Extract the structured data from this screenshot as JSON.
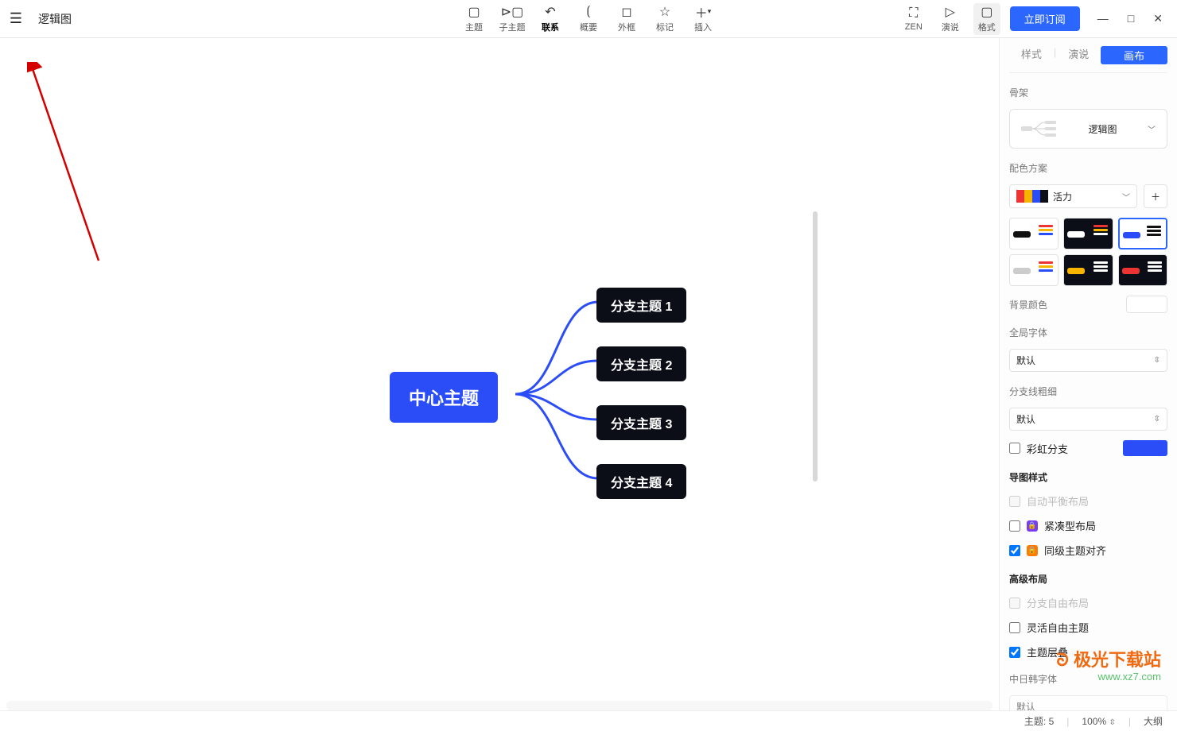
{
  "header": {
    "doc_title": "逻辑图",
    "toolbar": [
      {
        "icon": "▢",
        "label": "主题"
      },
      {
        "icon": "⊳▢",
        "label": "子主题"
      },
      {
        "icon": "↶",
        "label": "联系",
        "active": true
      },
      {
        "icon": "⟮ ",
        "label": "概要"
      },
      {
        "icon": "◻",
        "label": "外框"
      },
      {
        "icon": "☆",
        "label": "标记"
      },
      {
        "icon": "＋",
        "label": "插入",
        "sub": "▾"
      }
    ],
    "right_tools": [
      {
        "icon": "⛶",
        "label": "ZEN"
      },
      {
        "icon": "▷",
        "label": "演说"
      },
      {
        "icon": "▢",
        "label": "格式",
        "boxed": true
      }
    ],
    "subscribe": "立即订阅",
    "window": {
      "min": "—",
      "max": "□",
      "close": "✕"
    }
  },
  "mindmap": {
    "center": "中心主题",
    "branches": [
      "分支主题 1",
      "分支主题 2",
      "分支主题 3",
      "分支主题 4"
    ]
  },
  "panel": {
    "tabs": {
      "style": "样式",
      "pitch": "演说",
      "canvas": "画布"
    },
    "skeleton": {
      "label": "骨架",
      "value": "逻辑图"
    },
    "color": {
      "label": "配色方案",
      "value": "活力",
      "swatches": [
        "#e33",
        "#f7b500",
        "#2b4df7",
        "#0b0e17"
      ]
    },
    "background_label": "背景颜色",
    "global_font": {
      "label": "全局字体",
      "value": "默认"
    },
    "line_weight": {
      "label": "分支线粗细",
      "value": "默认"
    },
    "rainbow": "彩虹分支",
    "map_style": {
      "label": "导图样式",
      "auto": "自动平衡布局",
      "compact": "紧凑型布局",
      "align": "同级主题对齐"
    },
    "adv": {
      "label": "高级布局",
      "free": "分支自由布局",
      "flex": "灵活自由主题",
      "overlap": "主题层叠"
    },
    "cjk": {
      "label": "中日韩字体",
      "value": "默认"
    }
  },
  "status": {
    "topics_label": "主题:",
    "topics": "5",
    "zoom": "100%",
    "outline": "大纲"
  },
  "watermark": {
    "brand": "极光下载站",
    "site": "www.xz7.com"
  }
}
